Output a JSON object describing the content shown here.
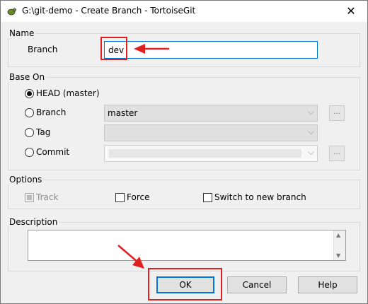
{
  "window": {
    "title": "G:\\git-demo - Create Branch - TortoiseGit",
    "close": "✕"
  },
  "name_group": {
    "label": "Name",
    "branch_label": "Branch",
    "branch_value": "dev"
  },
  "base_on": {
    "label": "Base On",
    "options": [
      {
        "label": "HEAD (master)",
        "checked": true
      },
      {
        "label": "Branch",
        "checked": false,
        "value": "master"
      },
      {
        "label": "Tag",
        "checked": false,
        "value": ""
      },
      {
        "label": "Commit",
        "checked": false,
        "value": ""
      }
    ],
    "browse": "..."
  },
  "options": {
    "label": "Options",
    "track": "Track",
    "force": "Force",
    "switch": "Switch to new branch"
  },
  "description": {
    "label": "Description",
    "value": ""
  },
  "buttons": {
    "ok": "OK",
    "cancel": "Cancel",
    "help": "Help"
  },
  "annotation_color": "#e02020"
}
